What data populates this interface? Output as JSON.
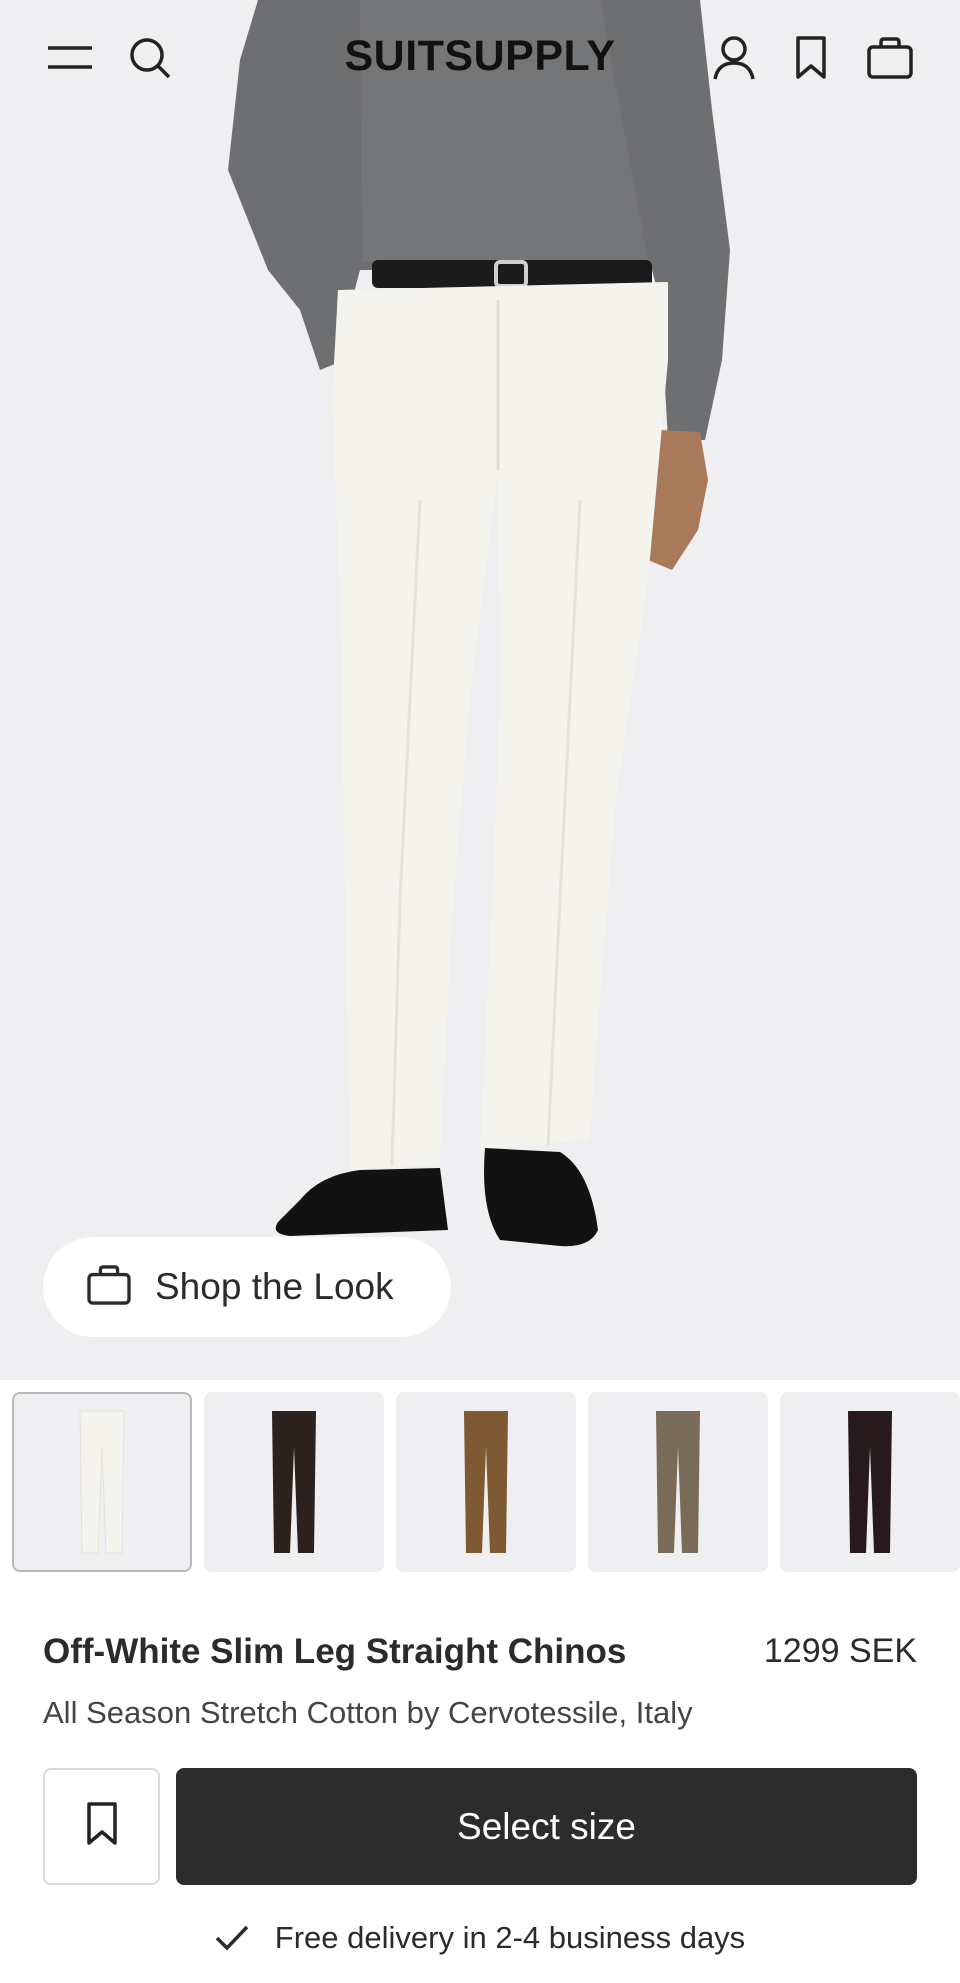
{
  "header": {
    "brand": "SUITSUPPLY",
    "icons": [
      "menu-icon",
      "search-icon",
      "account-icon",
      "bookmark-icon",
      "bag-icon"
    ]
  },
  "hero": {
    "shop_the_look_label": "Shop the Look",
    "shop_icon": "bag-icon"
  },
  "color_variants": [
    {
      "color": "#f4f3ee",
      "selected": true
    },
    {
      "color": "#2c211d",
      "selected": false
    },
    {
      "color": "#7d5a34",
      "selected": false
    },
    {
      "color": "#7a6a58",
      "selected": false
    },
    {
      "color": "#281a1c",
      "selected": false
    }
  ],
  "product": {
    "name": "Off-White Slim Leg Straight Chinos",
    "price": "1299 SEK",
    "subtitle": "All Season Stretch Cotton by Cervotessile, Italy"
  },
  "actions": {
    "select_size_label": "Select size",
    "wishlist_icon": "bookmark-icon"
  },
  "delivery": {
    "text": "Free delivery in 2-4 business days",
    "icon": "check-icon"
  },
  "colors": {
    "hero_background": "#efeef0",
    "primary_button": "#2c2c2c",
    "text": "#2b2b2b"
  }
}
